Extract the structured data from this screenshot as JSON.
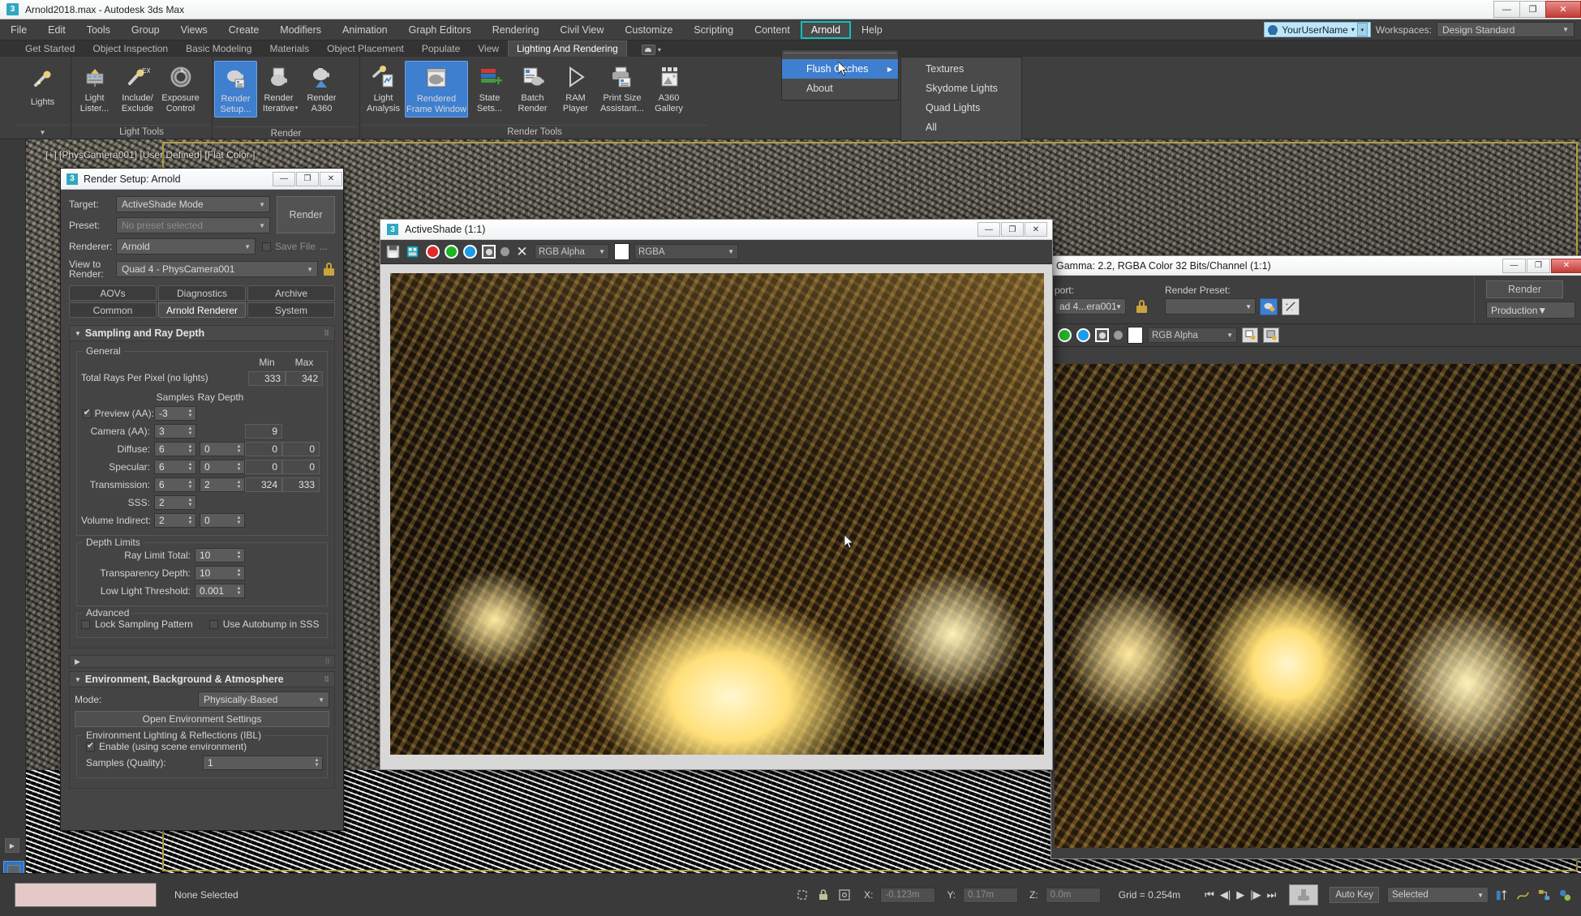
{
  "app": {
    "title": "Arnold2018.max - Autodesk 3ds Max",
    "icon": "3",
    "window_buttons": {
      "minimize": "—",
      "restore": "❐",
      "close": "✕"
    }
  },
  "menubar": {
    "items": [
      {
        "label": "File"
      },
      {
        "label": "Edit"
      },
      {
        "label": "Tools"
      },
      {
        "label": "Group"
      },
      {
        "label": "Views"
      },
      {
        "label": "Create"
      },
      {
        "label": "Modifiers"
      },
      {
        "label": "Animation"
      },
      {
        "label": "Graph Editors"
      },
      {
        "label": "Rendering"
      },
      {
        "label": "Civil View"
      },
      {
        "label": "Customize"
      },
      {
        "label": "Scripting"
      },
      {
        "label": "Content"
      },
      {
        "label": "Arnold",
        "active": true
      },
      {
        "label": "Help"
      }
    ],
    "user": "YourUserName",
    "workspaces_label": "Workspaces:",
    "workspace_value": "Design Standard"
  },
  "arnold_menu": {
    "items": [
      {
        "label": "Flush Caches",
        "highlighted": true,
        "has_submenu": true
      },
      {
        "label": "About",
        "highlighted": false,
        "has_submenu": false
      }
    ],
    "submenu": {
      "items": [
        "Textures",
        "Skydome Lights",
        "Quad Lights",
        "All"
      ]
    }
  },
  "ribbon": {
    "tabs": [
      {
        "label": "Get Started"
      },
      {
        "label": "Object Inspection"
      },
      {
        "label": "Basic Modeling"
      },
      {
        "label": "Materials"
      },
      {
        "label": "Object Placement"
      },
      {
        "label": "Populate"
      },
      {
        "label": "View"
      },
      {
        "label": "Lighting And Rendering",
        "selected": true
      }
    ],
    "groups": [
      {
        "label": "",
        "buttons": [
          {
            "label": "Lights",
            "icon": "light-icon",
            "selected": false,
            "dropdown": true
          }
        ]
      },
      {
        "label": "Light Tools",
        "buttons": [
          {
            "label": "Light Lister...",
            "icon": "light-lister-icon",
            "selected": false
          },
          {
            "label": "Include/ Exclude",
            "icon": "include-exclude-icon",
            "selected": false
          },
          {
            "label": "Exposure Control",
            "icon": "exposure-control-icon",
            "selected": false
          }
        ]
      },
      {
        "label": "Render",
        "buttons": [
          {
            "label": "Render Setup...",
            "icon": "render-setup-icon",
            "selected": true
          },
          {
            "label": "Render Iterative",
            "icon": "render-iterative-icon",
            "selected": false
          },
          {
            "label": "Render A360",
            "icon": "render-a360-icon",
            "selected": false
          }
        ]
      },
      {
        "label": "Render Tools",
        "buttons": [
          {
            "label": "Light Analysis",
            "icon": "light-analysis-icon",
            "selected": false
          },
          {
            "label": "Rendered Frame Window",
            "icon": "rendered-frame-window-icon",
            "selected": true
          },
          {
            "label": "State Sets...",
            "icon": "state-sets-icon",
            "selected": false
          },
          {
            "label": "Batch Render",
            "icon": "batch-render-icon",
            "selected": false
          },
          {
            "label": "RAM Player",
            "icon": "ram-player-icon",
            "selected": false
          },
          {
            "label": "Print Size Assistant...",
            "icon": "print-size-assistant-icon",
            "selected": false
          },
          {
            "label": "A360 Gallery",
            "icon": "a360-gallery-icon",
            "selected": false
          }
        ]
      }
    ]
  },
  "viewport": {
    "label": "[+] [PhysCamera001] [User Defined] [Flat Color ]"
  },
  "render_setup": {
    "title": "Render Setup: Arnold",
    "icon": "3",
    "window_buttons": {
      "minimize": "—",
      "maximize": "❐",
      "close": "✕"
    },
    "target_label": "Target:",
    "target_value": "ActiveShade Mode",
    "preset_label": "Preset:",
    "preset_value": "No preset selected",
    "renderer_label": "Renderer:",
    "renderer_value": "Arnold",
    "view_to_render_label": "View to Render:",
    "view_to_render_value": "Quad 4 - PhysCamera001",
    "render_button": "Render",
    "save_file_label": "Save File",
    "save_file_checked": false,
    "save_file_ellipsis": "...",
    "tabs_top": [
      {
        "label": "AOVs",
        "selected": false
      },
      {
        "label": "Diagnostics",
        "selected": false
      },
      {
        "label": "Archive",
        "selected": false
      }
    ],
    "tabs_bottom": [
      {
        "label": "Common",
        "selected": false
      },
      {
        "label": "Arnold Renderer",
        "selected": true
      },
      {
        "label": "System",
        "selected": false
      }
    ],
    "sampling": {
      "title": "Sampling and Ray Depth",
      "general_label": "General",
      "min_header": "Min",
      "max_header": "Max",
      "total_rays_label": "Total Rays Per Pixel (no lights)",
      "total_rays_min": "333",
      "total_rays_max": "342",
      "samples_header": "Samples",
      "ray_depth_header": "Ray Depth",
      "rows": [
        {
          "label": "Preview (AA):",
          "checkbox": true,
          "checked": true,
          "samples": "-3",
          "ray_depth": "",
          "min": "",
          "max": ""
        },
        {
          "label": "Camera (AA):",
          "checkbox": false,
          "checked": false,
          "samples": "3",
          "ray_depth": "",
          "min": "9",
          "max": ""
        },
        {
          "label": "Diffuse:",
          "checkbox": false,
          "checked": false,
          "samples": "6",
          "ray_depth": "0",
          "min": "0",
          "max": "0"
        },
        {
          "label": "Specular:",
          "checkbox": false,
          "checked": false,
          "samples": "6",
          "ray_depth": "0",
          "min": "0",
          "max": "0"
        },
        {
          "label": "Transmission:",
          "checkbox": false,
          "checked": false,
          "samples": "6",
          "ray_depth": "2",
          "min": "324",
          "max": "333"
        },
        {
          "label": "SSS:",
          "checkbox": false,
          "checked": false,
          "samples": "2",
          "ray_depth": "",
          "min": "",
          "max": ""
        },
        {
          "label": "Volume Indirect:",
          "checkbox": false,
          "checked": false,
          "samples": "2",
          "ray_depth": "0",
          "min": "",
          "max": ""
        }
      ],
      "depth_limits_label": "Depth Limits",
      "depth_limits": [
        {
          "label": "Ray Limit Total:",
          "value": "10"
        },
        {
          "label": "Transparency Depth:",
          "value": "10"
        },
        {
          "label": "Low Light Threshold:",
          "value": "0.001"
        }
      ],
      "advanced_label": "Advanced",
      "advanced": [
        {
          "label": "Lock Sampling Pattern",
          "checked": false
        },
        {
          "label": "Use Autobump in SSS",
          "checked": false
        }
      ]
    },
    "environment": {
      "title": "Environment, Background & Atmosphere",
      "mode_label": "Mode:",
      "mode_value": "Physically-Based",
      "open_env_button": "Open Environment Settings",
      "ibl_label": "Environment Lighting & Reflections (IBL)",
      "enable_label": "Enable (using scene environment)",
      "enable_checked": true,
      "samples_label": "Samples (Quality):",
      "samples_value": "1"
    }
  },
  "activeshade": {
    "title": "ActiveShade (1:1)",
    "icon": "3",
    "window_buttons": {
      "minimize": "—",
      "maximize": "❐",
      "close": "✕"
    },
    "toolbar": {
      "save_icon": "save-icon",
      "clone_icon": "clone-icon",
      "red_channel": "red-channel-toggle",
      "green_channel": "green-channel-toggle",
      "blue_channel": "blue-channel-toggle",
      "alpha_channel": "alpha-channel-toggle",
      "mono_channel": "monochrome-toggle",
      "clear_icon": "clear-icon",
      "channel_select": "RGB Alpha",
      "layer_select": "RGBA",
      "colors": {
        "red": "#e02a2a",
        "green": "#22b522",
        "blue": "#1b9bea",
        "swatch": "#ffffff"
      }
    }
  },
  "render_frame_window": {
    "title": "Gamma: 2.2, RGBA Color 32 Bits/Channel (1:1)",
    "window_buttons": {
      "minimize": "—",
      "maximize": "❐",
      "close": "✕"
    },
    "viewport_label": "port:",
    "viewport_value": "ad 4...era001",
    "render_preset_label": "Render Preset:",
    "render_preset_value": "",
    "render_button": "Render",
    "production_value": "Production",
    "channel_select": "RGB Alpha",
    "colors": {
      "red": "#e02a2a",
      "green": "#22b522",
      "blue": "#1b9bea"
    }
  },
  "statusbar": {
    "material_swatch_color": "#e3cac8",
    "selection_text": "None Selected",
    "x_label": "X:",
    "x_value": "-0.123m",
    "y_label": "Y:",
    "y_value": "0.17m",
    "z_label": "Z:",
    "z_value": "0.0m",
    "grid_text": "Grid = 0.254m",
    "auto_key_label": "Auto Key",
    "selection_filter": "Selected",
    "transport": [
      "⏮",
      "◀|",
      "▶",
      "|▶",
      "⏭"
    ]
  }
}
